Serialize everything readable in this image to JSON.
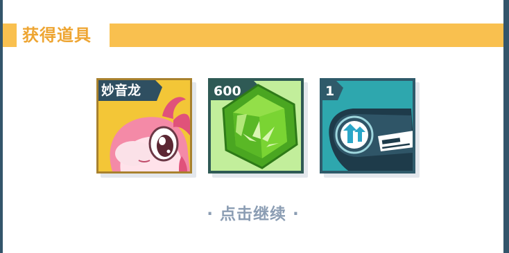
{
  "header": {
    "title": "获得道具"
  },
  "items": [
    {
      "qty_label": "妙音龙",
      "icon": "pink-dragon-icon",
      "bg": "#f3c637"
    },
    {
      "qty_label": "600",
      "icon": "green-gem-icon",
      "bg": "#c2ee9b"
    },
    {
      "qty_label": "1",
      "icon": "block-card-icon",
      "bg": "#2ea7ae"
    }
  ],
  "footer": {
    "continue_label": "· 点击继续 ·"
  },
  "colors": {
    "accent": "#f9c04f",
    "title": "#eea532",
    "frame": "#33556b"
  }
}
